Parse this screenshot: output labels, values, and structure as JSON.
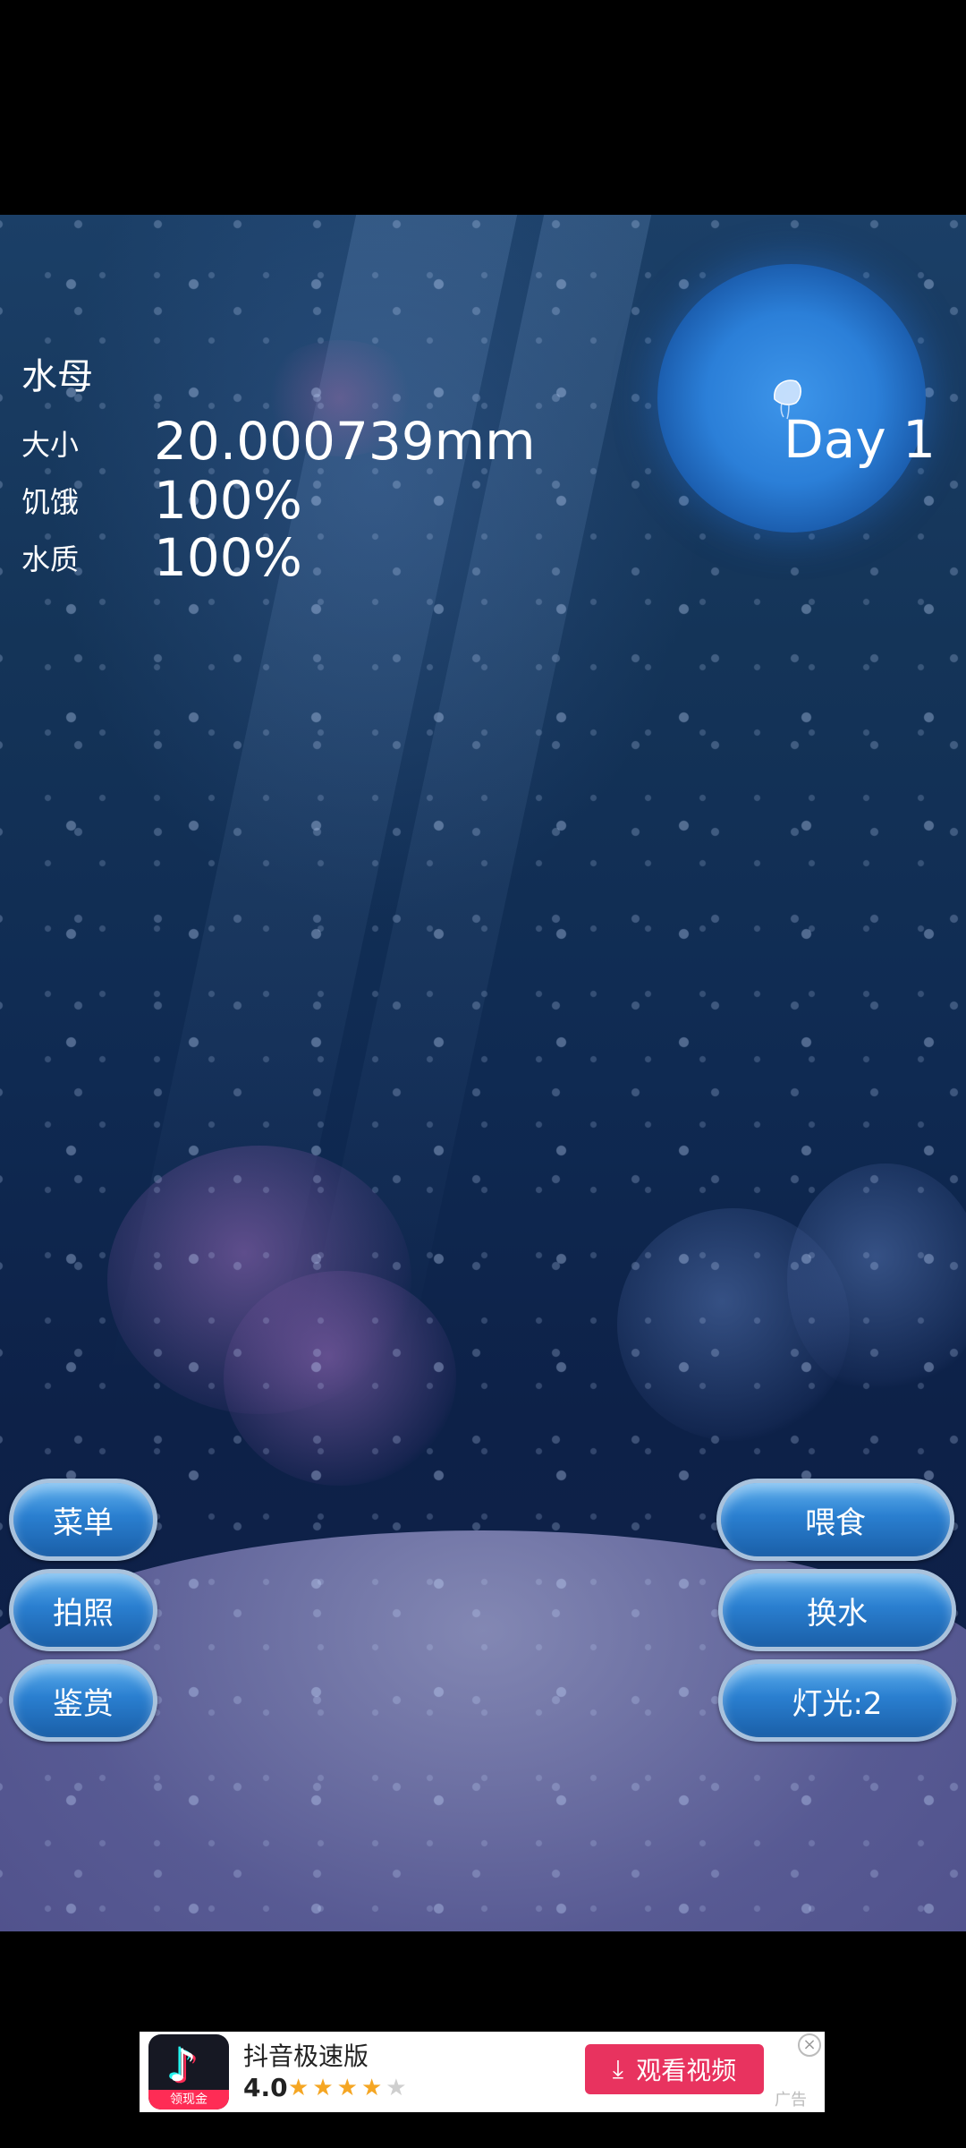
{
  "hud": {
    "title": "水母",
    "size_label": "大小",
    "size_value": "20.000739mm",
    "hunger_label": "饥饿",
    "hunger_value": "100%",
    "water_label": "水质",
    "water_value": "100%",
    "day": "Day 1"
  },
  "buttons": {
    "menu": "菜单",
    "photo": "拍照",
    "appraise": "鉴赏",
    "feed": "喂食",
    "change_water": "换水",
    "light": "灯光:2"
  },
  "ad": {
    "app_name": "抖音极速版",
    "rating": "4.0",
    "stars_filled": 4,
    "stars_total": 5,
    "cta": "观看视频",
    "badge": "领现金",
    "tag": "广告"
  },
  "colors": {
    "button_top": "#5fb0ee",
    "button_bottom": "#1a5fa8",
    "ad_cta": "#e8335f"
  }
}
